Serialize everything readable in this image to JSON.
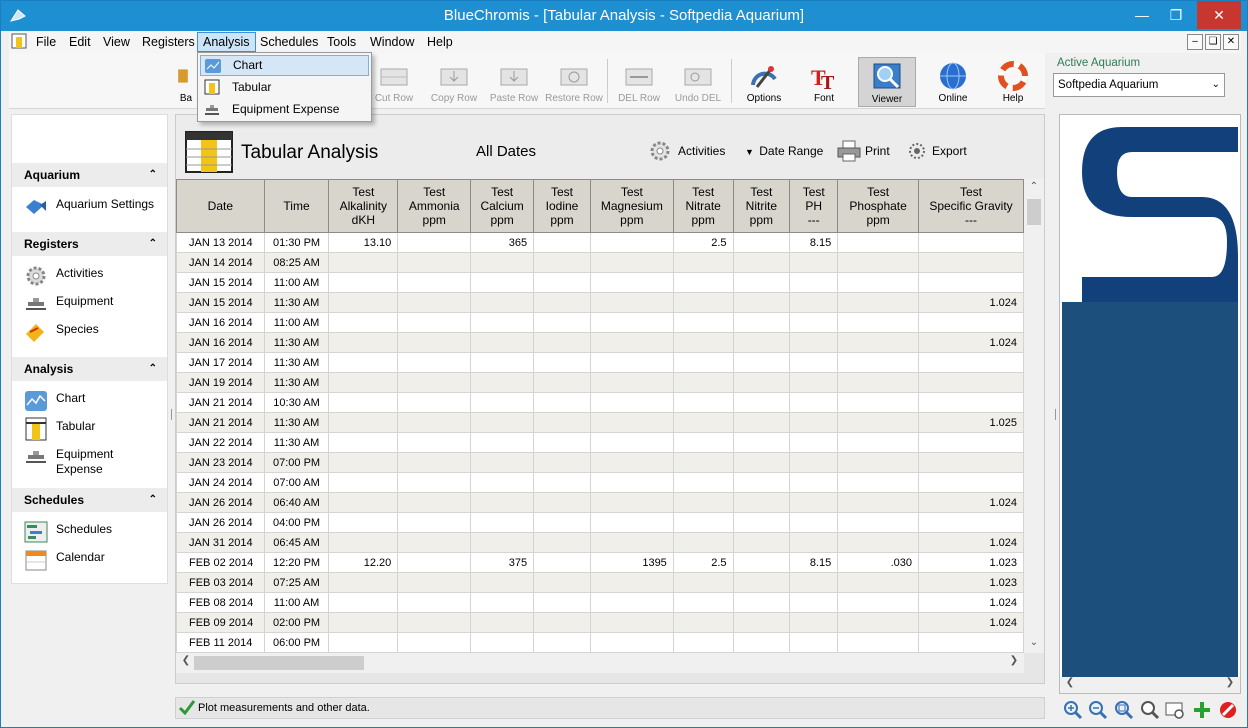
{
  "window": {
    "title": "BlueChromis - [Tabular Analysis  -  Softpedia Aquarium]"
  },
  "menu": [
    "File",
    "Edit",
    "View",
    "Registers",
    "Analysis",
    "Schedules",
    "Tools",
    "Window",
    "Help"
  ],
  "toolbar": {
    "buttons": [
      "Cut Row",
      "Copy Row",
      "Paste Row",
      "Restore Row",
      "DEL Row",
      "Undo DEL",
      "Options",
      "Font",
      "Viewer",
      "Online",
      "Help"
    ],
    "partial_label": "Ba"
  },
  "active_aquarium": {
    "label": "Active Aquarium",
    "value": "Softpedia Aquarium"
  },
  "analysis_menu": [
    "Chart",
    "Tabular",
    "Equipment Expense"
  ],
  "sidebar": {
    "sections": [
      {
        "title": "Aquarium",
        "items": [
          "Aquarium Settings"
        ]
      },
      {
        "title": "Registers",
        "items": [
          "Activities",
          "Equipment",
          "Species"
        ]
      },
      {
        "title": "Analysis",
        "items": [
          "Chart",
          "Tabular",
          "Equipment Expense"
        ]
      },
      {
        "title": "Schedules",
        "items": [
          "Schedules",
          "Calendar"
        ]
      }
    ]
  },
  "content": {
    "title": "Tabular Analysis",
    "date_range": "All Dates",
    "actions": [
      "Activities",
      "Date Range",
      "Print",
      "Export"
    ]
  },
  "table": {
    "columns": [
      [
        "Date"
      ],
      [
        "Time"
      ],
      [
        "Test",
        "Alkalinity",
        "dKH"
      ],
      [
        "Test",
        "Ammonia",
        "ppm"
      ],
      [
        "Test",
        "Calcium",
        "ppm"
      ],
      [
        "Test",
        "Iodine",
        "ppm"
      ],
      [
        "Test",
        "Magnesium",
        "ppm"
      ],
      [
        "Test",
        "Nitrate",
        "ppm"
      ],
      [
        "Test",
        "Nitrite",
        "ppm"
      ],
      [
        "Test",
        "PH",
        "---"
      ],
      [
        "Test",
        "Phosphate",
        "ppm"
      ],
      [
        "Test",
        "Specific Gravity",
        "---"
      ]
    ],
    "rows": [
      [
        "JAN 13 2014",
        "01:30 PM",
        "13.10",
        "",
        "365",
        "",
        "",
        "2.5",
        "",
        "8.15",
        "",
        ""
      ],
      [
        "JAN 14 2014",
        "08:25 AM",
        "",
        "",
        "",
        "",
        "",
        "",
        "",
        "",
        "",
        ""
      ],
      [
        "JAN 15 2014",
        "11:00 AM",
        "",
        "",
        "",
        "",
        "",
        "",
        "",
        "",
        "",
        ""
      ],
      [
        "JAN 15 2014",
        "11:30 AM",
        "",
        "",
        "",
        "",
        "",
        "",
        "",
        "",
        "",
        "1.024"
      ],
      [
        "JAN 16 2014",
        "11:00 AM",
        "",
        "",
        "",
        "",
        "",
        "",
        "",
        "",
        "",
        ""
      ],
      [
        "JAN 16 2014",
        "11:30 AM",
        "",
        "",
        "",
        "",
        "",
        "",
        "",
        "",
        "",
        "1.024"
      ],
      [
        "JAN 17 2014",
        "11:30 AM",
        "",
        "",
        "",
        "",
        "",
        "",
        "",
        "",
        "",
        ""
      ],
      [
        "JAN 19 2014",
        "11:30 AM",
        "",
        "",
        "",
        "",
        "",
        "",
        "",
        "",
        "",
        ""
      ],
      [
        "JAN 21 2014",
        "10:30 AM",
        "",
        "",
        "",
        "",
        "",
        "",
        "",
        "",
        "",
        ""
      ],
      [
        "JAN 21 2014",
        "11:30 AM",
        "",
        "",
        "",
        "",
        "",
        "",
        "",
        "",
        "",
        "1.025"
      ],
      [
        "JAN 22 2014",
        "11:30 AM",
        "",
        "",
        "",
        "",
        "",
        "",
        "",
        "",
        "",
        ""
      ],
      [
        "JAN 23 2014",
        "07:00 PM",
        "",
        "",
        "",
        "",
        "",
        "",
        "",
        "",
        "",
        ""
      ],
      [
        "JAN 24 2014",
        "07:00 AM",
        "",
        "",
        "",
        "",
        "",
        "",
        "",
        "",
        "",
        ""
      ],
      [
        "JAN 26 2014",
        "06:40 AM",
        "",
        "",
        "",
        "",
        "",
        "",
        "",
        "",
        "",
        "1.024"
      ],
      [
        "JAN 26 2014",
        "04:00 PM",
        "",
        "",
        "",
        "",
        "",
        "",
        "",
        "",
        "",
        ""
      ],
      [
        "JAN 31 2014",
        "06:45 AM",
        "",
        "",
        "",
        "",
        "",
        "",
        "",
        "",
        "",
        "1.024"
      ],
      [
        "FEB 02 2014",
        "12:20 PM",
        "12.20",
        "",
        "375",
        "",
        "1395",
        "2.5",
        "",
        "8.15",
        ".030",
        "1.023"
      ],
      [
        "FEB 03 2014",
        "07:25 AM",
        "",
        "",
        "",
        "",
        "",
        "",
        "",
        "",
        "",
        "1.023"
      ],
      [
        "FEB 08 2014",
        "11:00 AM",
        "",
        "",
        "",
        "",
        "",
        "",
        "",
        "",
        "",
        "1.024"
      ],
      [
        "FEB 09 2014",
        "02:00 PM",
        "",
        "",
        "",
        "",
        "",
        "",
        "",
        "",
        "",
        "1.024"
      ],
      [
        "FEB 11 2014",
        "06:00 PM",
        "",
        "",
        "",
        "",
        "",
        "",
        "",
        "",
        "",
        ""
      ],
      [
        "",
        "",
        "",
        "",
        "",
        "",
        "",
        "",
        "",
        "",
        "",
        ""
      ]
    ]
  },
  "status": {
    "text": "Plot measurements and other data."
  },
  "colors": {
    "titlebar": "#1e8fd0",
    "header_bg": "#d8d5cc",
    "alt_row": "#f0efea",
    "viewer_blue": "#1c4f7c"
  },
  "icons": [
    "app-icon",
    "minimize-icon",
    "maximize-icon",
    "close-icon",
    "options-icon",
    "font-icon",
    "viewer-icon",
    "online-icon",
    "help-icon",
    "zoom-in-icon",
    "zoom-out-icon",
    "zoom-fit-icon",
    "zoom-icon",
    "screenshot-icon",
    "add-icon",
    "remove-icon"
  ]
}
